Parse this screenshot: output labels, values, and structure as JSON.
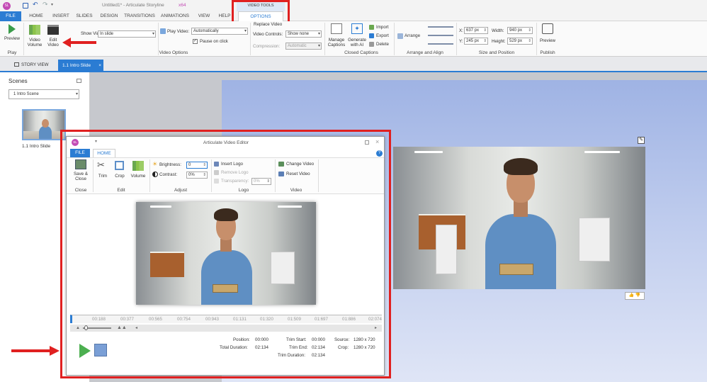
{
  "app": {
    "title": "Untitled1* - Articulate Storyline",
    "title_suffix": "x64",
    "logo": "SL"
  },
  "video_tools": {
    "group_label": "VIDEO TOOLS",
    "options_tab": "OPTIONS"
  },
  "tabs": [
    "FILE",
    "HOME",
    "INSERT",
    "SLIDES",
    "DESIGN",
    "TRANSITIONS",
    "ANIMATIONS",
    "VIEW",
    "HELP"
  ],
  "ribbon": {
    "play": {
      "preview": "Preview",
      "group": "Play"
    },
    "video_volume": "Video Volume",
    "edit_video": "Edit Video",
    "show_video": {
      "label": "Show Video:",
      "value": "In slide"
    },
    "play_video": {
      "label": "Play Video:",
      "value": "Automatically"
    },
    "pause_on_click": "Pause on click",
    "video_options_group": "Video Options",
    "replace_video": "Replace Video",
    "video_controls": {
      "label": "Video Controls:",
      "value": "Show none"
    },
    "compression": {
      "label": "Compression:",
      "value": "Automatic"
    },
    "manage_captions": "Manage Captions",
    "generate_ai": "Generate with AI",
    "import": "Import",
    "export": "Export",
    "delete": "Delete",
    "closed_captions_group": "Closed Captions",
    "arrange": "Arrange",
    "arrange_group": "Arrange and Align",
    "x": {
      "label": "X:",
      "value": "637 px"
    },
    "y": {
      "label": "Y:",
      "value": "245 px"
    },
    "width": {
      "label": "Width:",
      "value": "940 px"
    },
    "height": {
      "label": "Height:",
      "value": "529 px"
    },
    "size_group": "Size and Position",
    "preview_pub": "Preview",
    "publish_group": "Publish"
  },
  "view_tabs": {
    "story_view": "STORY VIEW",
    "slide_tab": "1.1 Intro Slide"
  },
  "scenes": {
    "title": "Scenes",
    "dropdown": "1 Intro Scene",
    "thumb_label": "1.1 Intro Slide"
  },
  "editor": {
    "title": "Articulate Video Editor",
    "logo": "SL",
    "tabs": [
      "FILE",
      "HOME"
    ],
    "save_close": "Save & Close",
    "close_group": "Close",
    "trim": "Trim",
    "crop": "Crop",
    "volume": "Volume",
    "edit_group": "Edit",
    "brightness": {
      "label": "Brightness:",
      "value": "0"
    },
    "contrast": {
      "label": "Contrast:",
      "value": "0%"
    },
    "adjust_group": "Adjust",
    "insert_logo": "Insert Logo",
    "remove_logo": "Remove Logo",
    "transparency": {
      "label": "Transparency:",
      "value": "0%"
    },
    "logo_group": "Logo",
    "change_video": "Change Video",
    "reset_video": "Reset Video",
    "video_group": "Video",
    "timeline": [
      "00:188",
      "00:377",
      "00:565",
      "00:754",
      "00:943",
      "01:131",
      "01:320",
      "01:509",
      "01:697",
      "01:886",
      "02:074"
    ],
    "info": {
      "position_label": "Position:",
      "position": "00:000",
      "total_label": "Total Duration:",
      "total": "02:134",
      "trim_start_label": "Trim Start:",
      "trim_start": "00:000",
      "trim_end_label": "Trim End:",
      "trim_end": "02:134",
      "trim_dur_label": "Trim Duration:",
      "trim_dur": "02:134",
      "source_label": "Source:",
      "source": "1280 x 720",
      "crop_label": "Crop:",
      "crop": "1280 x 720"
    }
  },
  "colors": {
    "accent": "#2b7cd3",
    "annotation": "#e02020",
    "logo": "#c34bb5",
    "play": "#4caf50",
    "stop": "#7a9fd6"
  }
}
